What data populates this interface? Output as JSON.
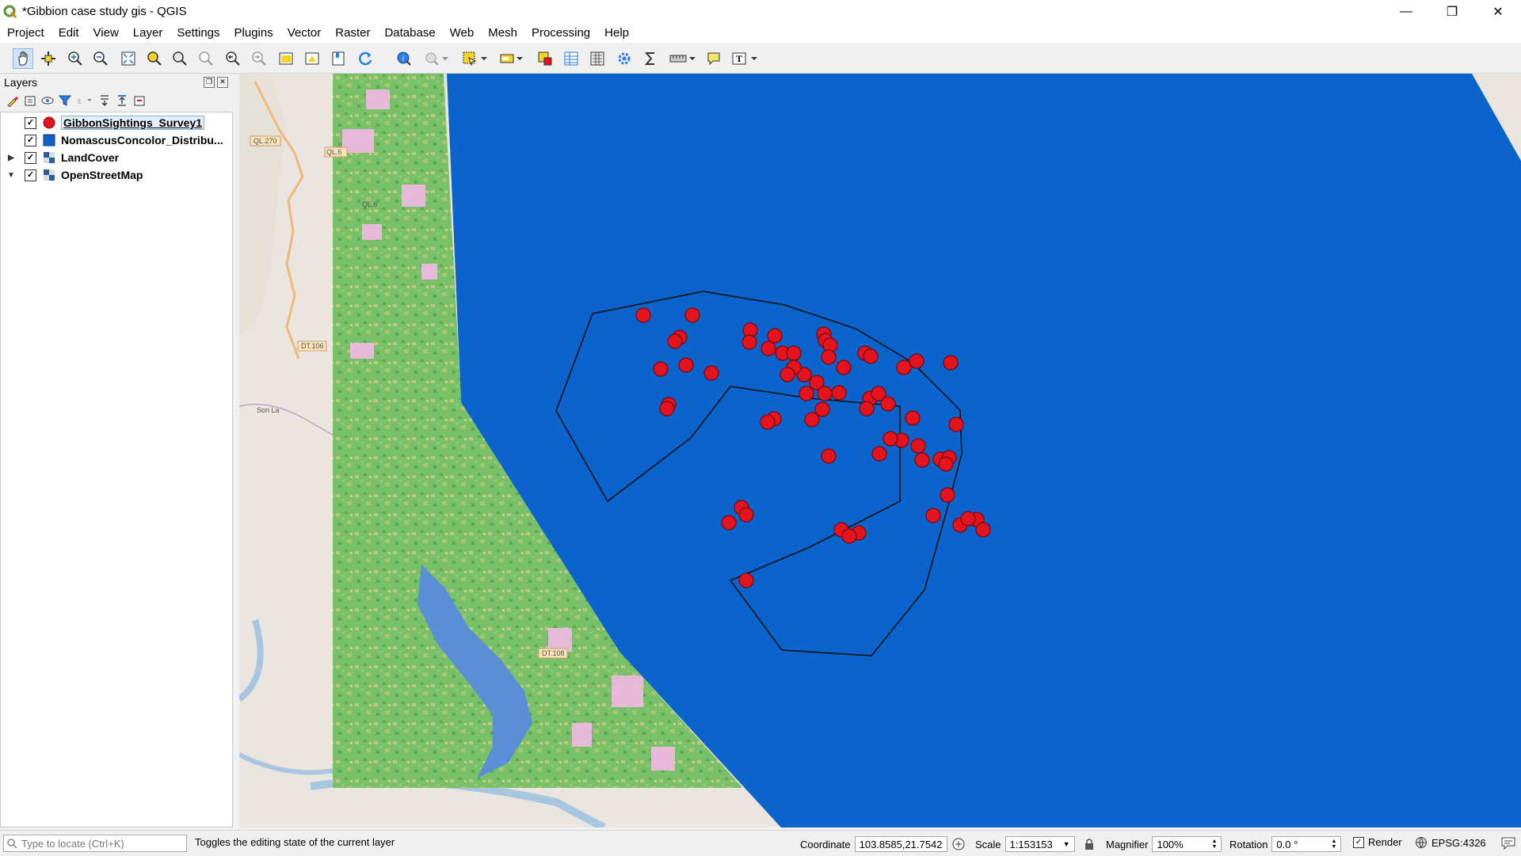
{
  "window": {
    "title": "*Gibbion case study gis - QGIS",
    "minimize": "—",
    "maximize": "❐",
    "close": "✕"
  },
  "menu": [
    "Project",
    "Edit",
    "View",
    "Layer",
    "Settings",
    "Plugins",
    "Vector",
    "Raster",
    "Database",
    "Web",
    "Mesh",
    "Processing",
    "Help"
  ],
  "layers_panel": {
    "title": "Layers",
    "layers": [
      {
        "name": "GibbonSightings_Survey1",
        "checked": "✓",
        "expander": "",
        "symbol": "red-circle-point",
        "color": "#e3141e"
      },
      {
        "name": "NomascusConcolor_Distribu...",
        "checked": "✓",
        "expander": "",
        "symbol": "blue-square-polygon",
        "color": "#1060c8"
      },
      {
        "name": "LandCover",
        "checked": "✓",
        "expander": "▶",
        "symbol": "raster-icon"
      },
      {
        "name": "OpenStreetMap",
        "checked": "✓",
        "expander": "▼",
        "symbol": "raster-icon"
      }
    ]
  },
  "map": {
    "colors": {
      "distribution": "#0b63cc",
      "landcover": "#78c168",
      "sighting": "#e3141e",
      "osm": "#eae6df"
    },
    "labels": [
      "QL.270",
      "QL.6",
      "DT.106",
      "Son La",
      "DT.108",
      "QL.6"
    ],
    "sightings_count": 64
  },
  "status": {
    "locator_placeholder": "Type to locate (Ctrl+K)",
    "message": "Toggles the editing state of the current layer",
    "coordinate_label": "Coordinate",
    "coordinate_value": "103.8585,21.7542",
    "scale_label": "Scale",
    "scale_value": "1:153153",
    "magnifier_label": "Magnifier",
    "magnifier_value": "100%",
    "rotation_label": "Rotation",
    "rotation_value": "0.0 °",
    "render_label": "Render",
    "render_checked": "✓",
    "crs": "EPSG:4326"
  }
}
